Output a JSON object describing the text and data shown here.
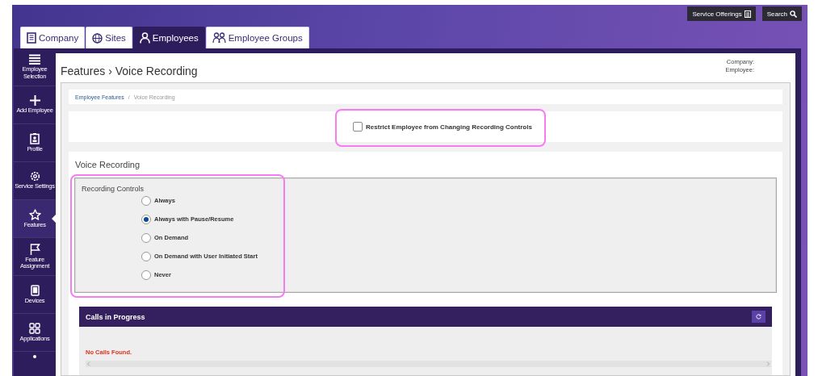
{
  "top_buttons": [
    {
      "label": "Service Offerings",
      "kind": "offerings"
    },
    {
      "label": "Search",
      "kind": "search"
    }
  ],
  "tabs": [
    {
      "label": "Company",
      "kind": "company",
      "selected": false
    },
    {
      "label": "Sites",
      "kind": "sites",
      "selected": false
    },
    {
      "label": "Employees",
      "kind": "employee",
      "selected": true
    },
    {
      "label": "Employee Groups",
      "kind": "groups",
      "selected": false
    }
  ],
  "sidebar": {
    "items": [
      {
        "label": "Employee Selection",
        "kind": "list",
        "selected": false
      },
      {
        "label": "Add Employee",
        "kind": "add",
        "selected": false
      },
      {
        "label": "Profile",
        "kind": "profile",
        "selected": false
      },
      {
        "label": "Service Settings",
        "kind": "settings",
        "selected": false
      },
      {
        "label": "Features",
        "kind": "star",
        "selected": true
      },
      {
        "label": "Feature Assignment",
        "kind": "flag",
        "selected": false
      },
      {
        "label": "Devices",
        "kind": "device",
        "selected": false
      },
      {
        "label": "Applications",
        "kind": "apps",
        "selected": false
      }
    ]
  },
  "page": {
    "title": "Features › Voice Recording",
    "context": [
      "Company:",
      "Employee:"
    ],
    "breadcrumb": {
      "link": "Employee Features",
      "separator": "/",
      "current": "Voice Recording"
    },
    "restrict": {
      "label": "Restrict Employee from Changing Recording Controls",
      "checked": false,
      "highlighted": true
    },
    "section": {
      "title": "Voice Recording",
      "group": {
        "legend": "Recording Controls",
        "highlighted": true,
        "options": [
          {
            "label": "Always",
            "selected": false
          },
          {
            "label": "Always with Pause/Resume",
            "selected": true
          },
          {
            "label": "On Demand",
            "selected": false
          },
          {
            "label": "On Demand with User Initiated Start",
            "selected": false
          },
          {
            "label": "Never",
            "selected": false
          }
        ]
      }
    },
    "calls": {
      "title": "Calls in Progress",
      "message": "No Calls Found."
    }
  }
}
